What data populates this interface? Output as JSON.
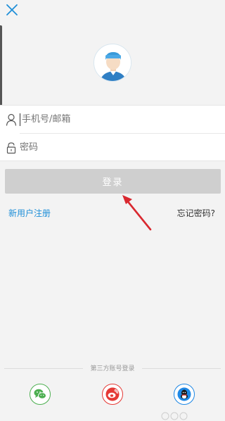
{
  "header": {
    "close_icon": "close-icon"
  },
  "form": {
    "phone": {
      "icon": "user-icon",
      "placeholder": "手机号/邮箱"
    },
    "password": {
      "icon": "lock-icon",
      "placeholder": "密码"
    }
  },
  "actions": {
    "login_label": "登录",
    "register_label": "新用户注册",
    "forgot_label": "忘记密码?"
  },
  "third_party": {
    "label": "第三方账号登录",
    "providers": [
      "wechat-icon",
      "weibo-icon",
      "qq-icon"
    ]
  },
  "colors": {
    "background": "#f3f3f3",
    "accent": "#1f8fd8",
    "login_button": "#cfcfcf",
    "annotation_arrow": "#d9282f"
  }
}
